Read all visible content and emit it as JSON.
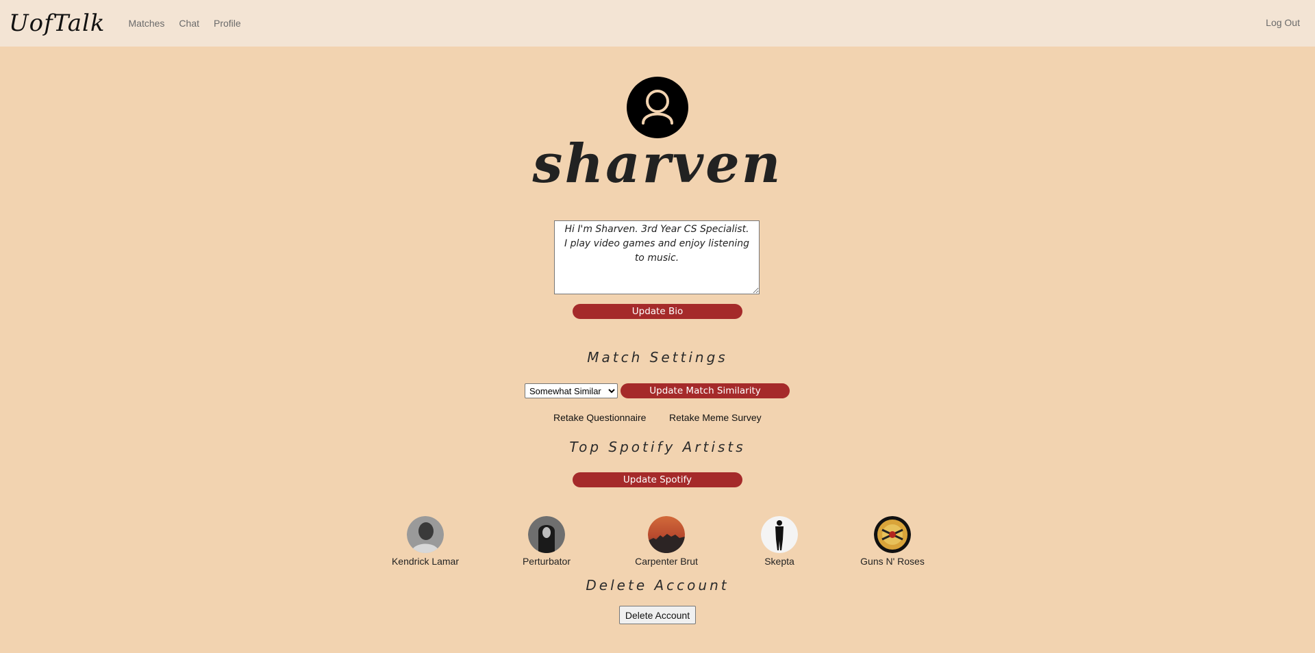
{
  "nav": {
    "brand": "UofTalk",
    "links": [
      "Matches",
      "Chat",
      "Profile"
    ],
    "logout": "Log Out"
  },
  "profile": {
    "avatar_icon": "user-icon",
    "username": "sharven",
    "bio": "Hi I'm Sharven. 3rd Year CS Specialist.\nI play video games and enjoy listening to music.",
    "update_bio_label": "Update Bio"
  },
  "match_settings": {
    "heading": "Match Settings",
    "similarity_value": "Somewhat Similar",
    "update_label": "Update Match Similarity",
    "retake_questionnaire": "Retake Questionnaire",
    "retake_meme_survey": "Retake Meme Survey"
  },
  "spotify": {
    "heading": "Top Spotify Artists",
    "update_label": "Update Spotify",
    "artists": [
      {
        "name": "Kendrick Lamar"
      },
      {
        "name": "Perturbator"
      },
      {
        "name": "Carpenter Brut"
      },
      {
        "name": "Skepta"
      },
      {
        "name": "Guns N' Roses"
      }
    ]
  },
  "delete": {
    "heading": "Delete Account",
    "button_label": "Delete Account"
  },
  "colors": {
    "background": "#f2d3b0",
    "navbar": "#f3e4d4",
    "accent": "#a52a2a"
  }
}
